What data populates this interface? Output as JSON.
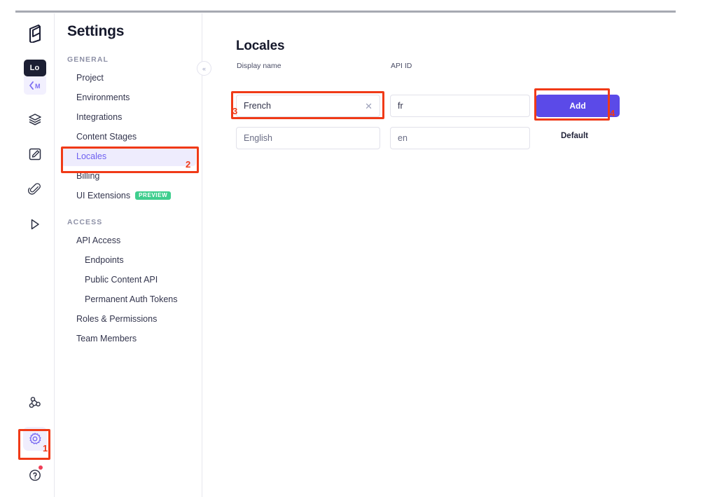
{
  "app": {
    "brand_icon": "hygraph-logo-icon",
    "accent_color": "#5b4ae8",
    "annotation_color": "#f03a17"
  },
  "rail": {
    "logo_label": "hygraph-logo",
    "tooltip_chip": "Lo",
    "chip_under_label": "CM",
    "items": [
      {
        "name": "schema-icon",
        "label": "Schema"
      },
      {
        "name": "content-icon",
        "label": "Content"
      },
      {
        "name": "assets-icon",
        "label": "Assets"
      },
      {
        "name": "api-playground-icon",
        "label": "API Playground"
      }
    ],
    "bottom_items": [
      {
        "name": "webhooks-icon",
        "label": "Webhooks"
      },
      {
        "name": "settings-gear-icon",
        "label": "Settings"
      },
      {
        "name": "help-icon",
        "label": "Help"
      }
    ]
  },
  "nav": {
    "title": "Settings",
    "collapse_label": "«",
    "sections": [
      {
        "label": "GENERAL",
        "items": [
          {
            "label": "Project",
            "sub": false,
            "selected": false
          },
          {
            "label": "Environments",
            "sub": false,
            "selected": false
          },
          {
            "label": "Integrations",
            "sub": false,
            "selected": false
          },
          {
            "label": "Content Stages",
            "sub": false,
            "selected": false
          },
          {
            "label": "Locales",
            "sub": false,
            "selected": true
          },
          {
            "label": "Billing",
            "sub": false,
            "selected": false
          },
          {
            "label": "UI Extensions",
            "sub": false,
            "selected": false,
            "badge": "PREVIEW"
          }
        ]
      },
      {
        "label": "ACCESS",
        "items": [
          {
            "label": "API Access",
            "sub": false,
            "selected": false
          },
          {
            "label": "Endpoints",
            "sub": true,
            "selected": false
          },
          {
            "label": "Public Content API",
            "sub": true,
            "selected": false
          },
          {
            "label": "Permanent Auth Tokens",
            "sub": true,
            "selected": false
          },
          {
            "label": "Roles & Permissions",
            "sub": false,
            "selected": false
          },
          {
            "label": "Team Members",
            "sub": false,
            "selected": false
          }
        ]
      }
    ]
  },
  "main": {
    "title": "Locales",
    "columns": {
      "display_name": "Display name",
      "api_id": "API ID"
    },
    "new_row": {
      "display_name_value": "French",
      "display_name_placeholder": "Display name",
      "api_id_value": "fr",
      "api_id_placeholder": "API ID",
      "clear_icon": "close-icon",
      "add_label": "Add"
    },
    "existing_rows": [
      {
        "display_name_value": "English",
        "api_id_value": "en",
        "status": "Default"
      }
    ]
  },
  "annotations": [
    {
      "id": "1",
      "target": "settings-gear-icon"
    },
    {
      "id": "2",
      "target": "sidebar-item-locales"
    },
    {
      "id": "3",
      "target": "display-name-input"
    },
    {
      "id": "4",
      "target": "add-button"
    }
  ]
}
